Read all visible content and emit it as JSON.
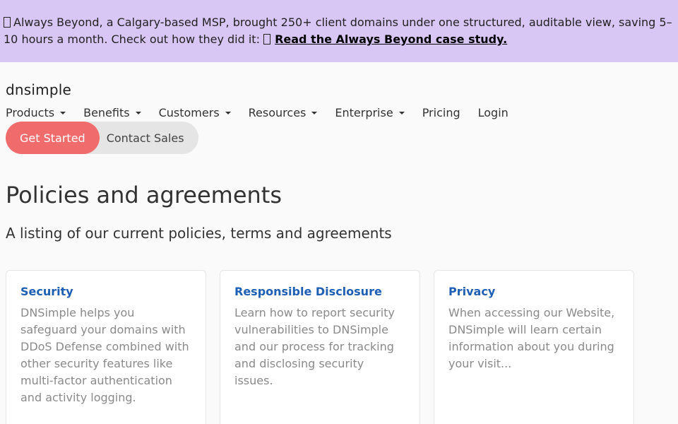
{
  "banner": {
    "text": "Always Beyond, a Calgary-based MSP, brought 250+ client domains under one structured, auditable view, saving 5–10 hours a month. Check out how they did it:",
    "link_text": "Read the Always Beyond case study."
  },
  "header": {
    "logo": "dnsimple",
    "nav": [
      {
        "label": "Products"
      },
      {
        "label": "Benefits"
      },
      {
        "label": "Customers"
      },
      {
        "label": "Resources"
      },
      {
        "label": "Enterprise"
      },
      {
        "label": "Pricing"
      },
      {
        "label": "Login"
      }
    ],
    "get_started": "Get Started",
    "contact_sales": "Contact Sales"
  },
  "main": {
    "title": "Policies and agreements",
    "subtitle": "A listing of our current policies, terms and agreements",
    "cards": [
      {
        "title": "Security",
        "body": "DNSimple helps you safeguard your domains with DDoS Defense combined with other security features like multi-factor authentication and activity logging."
      },
      {
        "title": "Responsible Disclosure",
        "body": "Learn how to report security vulnerabilities to DNSimple and our process for tracking and disclosing security issues."
      },
      {
        "title": "Privacy",
        "body": "When accessing our Website, DNSimple will learn certain information about you during your visit..."
      }
    ]
  },
  "colors": {
    "banner_bg": "#d8c6f5",
    "accent": "#f06b6b",
    "link": "#1d5fb4"
  }
}
